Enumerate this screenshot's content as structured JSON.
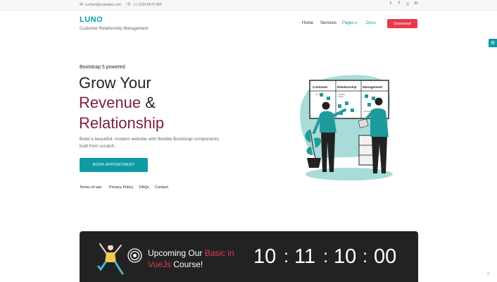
{
  "topbar": {
    "email": "contact@example.com",
    "phone": "+1 1234 5678 990",
    "socials": [
      {
        "icon": "twitter-icon",
        "glyph": "t"
      },
      {
        "icon": "facebook-icon",
        "glyph": "f"
      },
      {
        "icon": "instagram-icon",
        "glyph": "◎"
      },
      {
        "icon": "linkedin-icon",
        "glyph": "in"
      }
    ]
  },
  "header": {
    "logo": "LUNO",
    "tagline": "Customer Relationship Management",
    "nav": [
      "Home",
      "Services",
      "Pages",
      "Docs"
    ],
    "download": "Download"
  },
  "hero": {
    "pre": "Bootstrap 5 powered",
    "line1": "Grow Your",
    "line2_accent": "Revenue",
    "line2_rest": " &",
    "line3": "Relationship",
    "desc": "Build a beautiful, modern website with flexible Bootstrap components built from scratch.",
    "cta": "BOOK APPOINTMENT",
    "links": [
      "Terms of use",
      "Privacy Policy",
      "FAQs",
      "Contact"
    ]
  },
  "board": {
    "columns": [
      "Customer",
      "Relationship",
      "Management"
    ]
  },
  "banner": {
    "title_pre": "Upcoming Our ",
    "title_hl": "Basic in VueJs",
    "title_post": " Course!",
    "countdown": [
      "10",
      "11",
      "10",
      "00"
    ]
  },
  "colors": {
    "accent": "#0f9aa5",
    "brand_red": "#e8394d",
    "maroon": "#7b1f3c",
    "banner_bg": "#222222"
  }
}
